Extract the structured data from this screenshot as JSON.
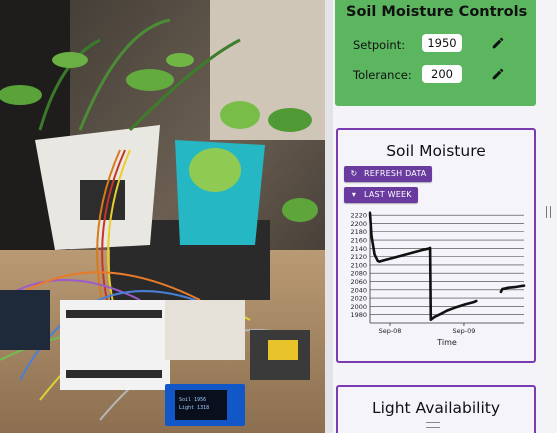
{
  "controls": {
    "title": "Soil Moisture Controls",
    "setpoint_label": "Setpoint:",
    "setpoint_value": "1950",
    "tolerance_label": "Tolerance:",
    "tolerance_value": "200"
  },
  "moisture_card": {
    "title": "Soil Moisture",
    "refresh_label": "REFRESH DATA",
    "range_label": "LAST WEEK"
  },
  "light_card": {
    "title": "Light Availability"
  },
  "photo": {
    "oled_lines": [
      "Soil  1956",
      "Light  1318"
    ]
  },
  "colors": {
    "controls_bg": "#5bb65f",
    "card_border": "#7b3bb0",
    "button_bg": "#6a3b9e"
  },
  "chart_data": {
    "type": "line",
    "xlabel": "Time",
    "x_tick_labels": [
      "Sep-08",
      "Sep-09"
    ],
    "ylim": [
      1960,
      2230
    ],
    "y_ticks": [
      1980,
      2000,
      2020,
      2040,
      2060,
      2080,
      2100,
      2120,
      2140,
      2160,
      2180,
      2200,
      2220
    ],
    "x_domain": [
      0,
      100
    ],
    "x_tick_positions": [
      13,
      61
    ],
    "grid": true,
    "series": [
      {
        "segments": [
          [
            [
              0,
              2225
            ],
            [
              1,
              2170
            ],
            [
              3,
              2125
            ],
            [
              5,
              2110
            ],
            [
              6,
              2108
            ],
            [
              10,
              2112
            ],
            [
              16,
              2118
            ],
            [
              22,
              2124
            ],
            [
              28,
              2130
            ],
            [
              34,
              2136
            ],
            [
              38,
              2139
            ],
            [
              39,
              2141
            ],
            [
              39.5,
              1968
            ],
            [
              42,
              1975
            ],
            [
              46,
              1982
            ],
            [
              50,
              1990
            ],
            [
              56,
              1998
            ],
            [
              62,
              2005
            ],
            [
              67,
              2010
            ],
            [
              69,
              2013
            ]
          ],
          [
            [
              85,
              2035
            ],
            [
              86,
              2042
            ],
            [
              90,
              2045
            ],
            [
              95,
              2047
            ],
            [
              98,
              2049
            ],
            [
              100,
              2050
            ]
          ]
        ]
      }
    ]
  }
}
